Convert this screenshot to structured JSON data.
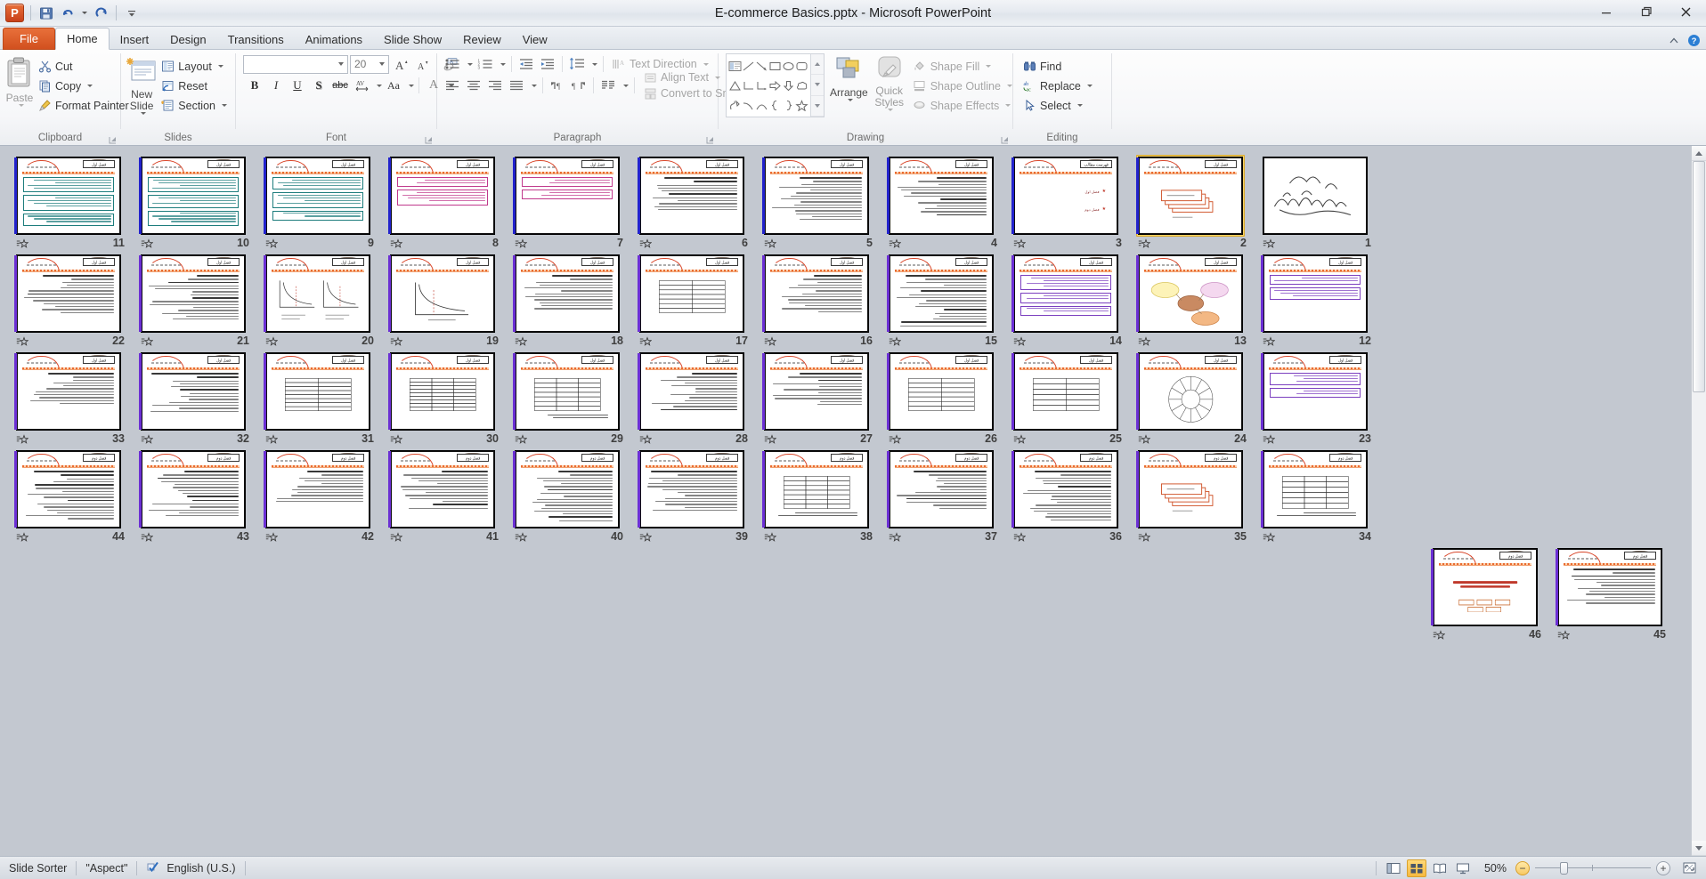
{
  "window": {
    "title": "E-commerce Basics.pptx  -  Microsoft PowerPoint",
    "app_logo": "powerpoint-logo",
    "minimize": "minimize-icon",
    "restore": "restore-icon",
    "close": "close-icon"
  },
  "quick_access": {
    "save": "save-icon",
    "undo": "undo-icon",
    "redo": "redo-icon",
    "customize": "customize-qat-icon"
  },
  "tabs": [
    {
      "label": "File",
      "active": false,
      "kind": "file"
    },
    {
      "label": "Home",
      "active": true,
      "kind": "normal"
    },
    {
      "label": "Insert",
      "active": false,
      "kind": "normal"
    },
    {
      "label": "Design",
      "active": false,
      "kind": "normal"
    },
    {
      "label": "Transitions",
      "active": false,
      "kind": "normal"
    },
    {
      "label": "Animations",
      "active": false,
      "kind": "normal"
    },
    {
      "label": "Slide Show",
      "active": false,
      "kind": "normal"
    },
    {
      "label": "Review",
      "active": false,
      "kind": "normal"
    },
    {
      "label": "View",
      "active": false,
      "kind": "normal"
    }
  ],
  "tab_right": {
    "minimize_ribbon": "ribbon-collapse-icon",
    "help": "help-icon"
  },
  "ribbon": {
    "groups": [
      {
        "label": "Clipboard",
        "has_dialog_launcher": true
      },
      {
        "label": "Slides",
        "has_dialog_launcher": false
      },
      {
        "label": "Font",
        "has_dialog_launcher": true
      },
      {
        "label": "Paragraph",
        "has_dialog_launcher": true
      },
      {
        "label": "Drawing",
        "has_dialog_launcher": true
      },
      {
        "label": "Editing",
        "has_dialog_launcher": false
      }
    ],
    "clipboard": {
      "paste": "Paste",
      "cut": "Cut",
      "copy": "Copy",
      "format_painter": "Format Painter"
    },
    "slides": {
      "new_slide": "New Slide",
      "layout": "Layout",
      "reset": "Reset",
      "section": "Section"
    },
    "font": {
      "font_name_value": "",
      "font_size_value": "20",
      "grow_font": "grow-font-icon",
      "shrink_font": "shrink-font-icon",
      "clear_formatting": "clear-formatting-icon",
      "bold": "B",
      "italic": "I",
      "underline": "U",
      "shadow": "S",
      "strikethrough": "abc",
      "character_spacing": "AV",
      "change_case": "Aa",
      "font_color": "A"
    },
    "paragraph": {
      "bullets": "bullets-icon",
      "numbering": "numbering-icon",
      "decrease_indent": "decrease-indent-icon",
      "increase_indent": "increase-indent-icon",
      "line_spacing": "line-spacing-icon",
      "align_left": "align-left-icon",
      "align_center": "align-center-icon",
      "align_right": "align-right-icon",
      "justify": "justify-icon",
      "ltr": "left-to-right-icon",
      "rtl": "right-to-left-icon",
      "columns": "columns-icon",
      "text_direction": "Text Direction",
      "align_text": "Align Text",
      "convert_to_smartart": "Convert to SmartArt"
    },
    "drawing": {
      "arrange": "Arrange",
      "quick_styles": "Quick Styles",
      "shape_fill": "Shape Fill",
      "shape_outline": "Shape Outline",
      "shape_effects": "Shape Effects"
    },
    "editing": {
      "find": "Find",
      "replace": "Replace",
      "select": "Select"
    }
  },
  "status_bar": {
    "view_name": "Slide Sorter",
    "theme_name": "\"Aspect\"",
    "spellcheck_icon": "spellcheck-icon",
    "language": "English (U.S.)",
    "views": [
      {
        "name": "normal-view",
        "active": false
      },
      {
        "name": "slide-sorter-view",
        "active": true
      },
      {
        "name": "reading-view",
        "active": false
      },
      {
        "name": "slide-show-view",
        "active": false
      }
    ],
    "zoom_level": "50%",
    "zoom_out": "zoom-out-icon",
    "zoom_in": "zoom-in-icon",
    "fit_to_window": "fit-to-window-icon"
  },
  "sorter": {
    "selected_slide": 2,
    "total_slides": 46,
    "rows": [
      {
        "slides": [
          11,
          10,
          9,
          8,
          7,
          6,
          5,
          4,
          3,
          2,
          1
        ]
      },
      {
        "slides": [
          22,
          21,
          20,
          19,
          18,
          17,
          16,
          15,
          14,
          13,
          12
        ]
      },
      {
        "slides": [
          33,
          32,
          31,
          30,
          29,
          28,
          27,
          26,
          25,
          24,
          23
        ]
      },
      {
        "slides": [
          44,
          43,
          42,
          41,
          40,
          39,
          38,
          37,
          36,
          35,
          34
        ]
      },
      {
        "slides": [
          46,
          45
        ]
      }
    ],
    "slide_header_tag_default": "فصل اول",
    "slide_header_tag_ch2": "فصل دوم",
    "slide_header_tag_toc": "فهرست مطالب",
    "toc_items": [
      "فصل اول",
      "فصل دوم"
    ],
    "title_slide_text": "بسم الله الرحمن الرحیم",
    "transition_icon": "slide-transition-star-icon"
  }
}
